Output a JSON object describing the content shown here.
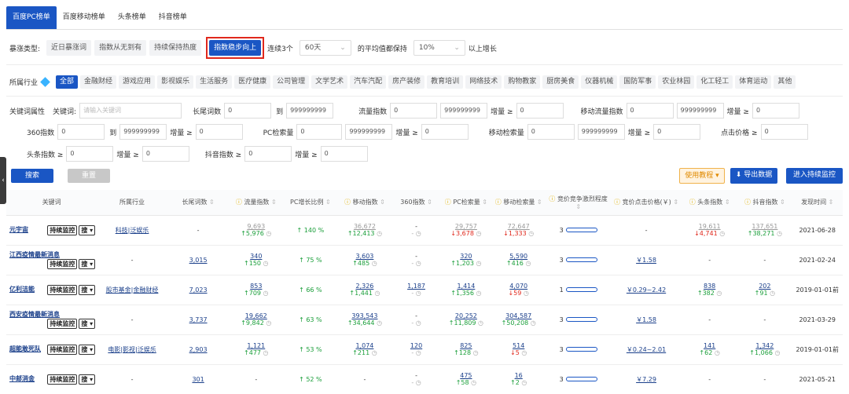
{
  "tabs": [
    "百度PC榜单",
    "百度移动榜单",
    "头条榜单",
    "抖音榜单"
  ],
  "rise": {
    "label": "暴涨类型:",
    "options": [
      "近日暴涨词",
      "指数从无到有",
      "持续保持热度",
      "指数稳步向上"
    ],
    "continuous_label": "连续3个",
    "days": "60天",
    "avg_label": "的平均值都保持",
    "pct": "10%",
    "suffix": "以上增长"
  },
  "industry": {
    "label": "所属行业",
    "items": [
      "全部",
      "金融财经",
      "游戏应用",
      "影视娱乐",
      "生活服务",
      "医疗健康",
      "公司管理",
      "文学艺术",
      "汽车汽配",
      "房产装修",
      "教育培训",
      "网络技术",
      "购物教家",
      "厨房美食",
      "仪器机械",
      "国防军事",
      "农业林园",
      "化工轻工",
      "体育运动",
      "其他"
    ]
  },
  "form": {
    "kw_attr": "关键词属性",
    "kw_label": "关键词:",
    "kw_placeholder": "请输入关键词",
    "long_label": "长尾词数",
    "flow_label": "流量指数",
    "mobile_flow_label": "移动流量指数",
    "idx360_label": "360指数",
    "pc_label": "PC检索量",
    "mobile_search_label": "移动检索量",
    "click_label": "点击价格 ≥",
    "toutiao_label": "头条指数 ≥",
    "douyin_label": "抖音指数 ≥",
    "zero": "0",
    "max": "999999999",
    "to": "到",
    "inc": "增量 ≥"
  },
  "buttons": {
    "search": "搜索",
    "reset": "重置",
    "tutorial": "使用教程",
    "export": "导出数据",
    "monitor": "进入持续监控"
  },
  "table": {
    "headers": [
      "关键词",
      "所属行业",
      "长尾词数",
      "流量指数",
      "PC增长比例",
      "移动指数",
      "360指数",
      "PC检索量",
      "移动检索量",
      "竞价竞争激烈程度",
      "竞价点击价格(￥)",
      "头条指数",
      "抖音指数",
      "发现时间"
    ],
    "monitor_btn": "持续监控",
    "search_btn": "搜",
    "rows": [
      {
        "kw": "元宇宙",
        "ind": "科技|泛娱乐",
        "long": "-",
        "flow": "9,693",
        "flow_d": "5,976",
        "flow_up": true,
        "pcg": "140 %",
        "mob": "36,672",
        "mob_d": "12,413",
        "mob_up": true,
        "i360": "-",
        "pc": "29,757",
        "pc_d": "3,678",
        "pc_up": false,
        "ms": "72,647",
        "ms_d": "1,333",
        "ms_up": false,
        "comp": "3",
        "price": "-",
        "tt": "19,611",
        "tt_d": "4,741",
        "tt_up": false,
        "dy": "137,651",
        "dy_d": "38,271",
        "dy_up": true,
        "date": "2021-06-28"
      },
      {
        "kw": "江西疫情最新消息",
        "ind": "-",
        "long": "3,015",
        "flow": "340",
        "flow_d": "150",
        "flow_up": true,
        "pcg": "75 %",
        "mob": "3,603",
        "mob_d": "485",
        "mob_up": true,
        "i360": "-",
        "pc": "320",
        "pc_d": "1,203",
        "pc_up": true,
        "ms": "5,590",
        "ms_d": "416",
        "ms_up": true,
        "comp": "3",
        "price": "￥1.58",
        "tt": "-",
        "tt_d": "",
        "tt_up": true,
        "dy": "-",
        "dy_d": "",
        "dy_up": true,
        "date": "2021-02-24"
      },
      {
        "kw": "亿利洁能",
        "ind": "股市基金|金融财经",
        "long": "7,023",
        "flow": "853",
        "flow_d": "709",
        "flow_up": true,
        "pcg": "66 %",
        "mob": "2,326",
        "mob_d": "1,441",
        "mob_up": true,
        "i360": "1,187",
        "pc": "1,414",
        "pc_d": "1,356",
        "pc_up": true,
        "ms": "4,070",
        "ms_d": "59",
        "ms_up": false,
        "comp": "1",
        "price": "￥0.29~2.42",
        "tt": "838",
        "tt_d": "382",
        "tt_up": true,
        "dy": "202",
        "dy_d": "91",
        "dy_up": true,
        "date": "2019-01-01前"
      },
      {
        "kw": "西安疫情最新消息",
        "ind": "-",
        "long": "3,737",
        "flow": "19,662",
        "flow_d": "9,842",
        "flow_up": true,
        "pcg": "63 %",
        "mob": "393,543",
        "mob_d": "34,644",
        "mob_up": true,
        "i360": "-",
        "pc": "20,252",
        "pc_d": "11,809",
        "pc_up": true,
        "ms": "304,587",
        "ms_d": "50,208",
        "ms_up": true,
        "comp": "3",
        "price": "￥1.58",
        "tt": "-",
        "tt_d": "",
        "tt_up": true,
        "dy": "-",
        "dy_d": "",
        "dy_up": true,
        "date": "2021-03-29"
      },
      {
        "kw": "超能敢死队",
        "ind": "电影|影视|泛娱乐",
        "long": "2,903",
        "flow": "1,121",
        "flow_d": "477",
        "flow_up": true,
        "pcg": "53 %",
        "mob": "1,074",
        "mob_d": "211",
        "mob_up": true,
        "i360": "120",
        "pc": "825",
        "pc_d": "128",
        "pc_up": true,
        "ms": "514",
        "ms_d": "5",
        "ms_up": false,
        "comp": "3",
        "price": "￥0.24~2.01",
        "tt": "141",
        "tt_d": "62",
        "tt_up": true,
        "dy": "1,342",
        "dy_d": "1,066",
        "dy_up": true,
        "date": "2019-01-01前"
      },
      {
        "kw": "中邮消金",
        "ind": "-",
        "long": "301",
        "flow": "-",
        "flow_d": "",
        "flow_up": true,
        "pcg": "52 %",
        "mob": "-",
        "mob_d": "",
        "mob_up": true,
        "i360": "-",
        "pc": "475",
        "pc_d": "58",
        "pc_up": true,
        "ms": "16",
        "ms_d": "2",
        "ms_up": true,
        "comp": "3",
        "price": "￥7.29",
        "tt": "-",
        "tt_d": "",
        "tt_up": true,
        "dy": "-",
        "dy_d": "",
        "dy_up": true,
        "date": "2021-05-21"
      }
    ]
  }
}
